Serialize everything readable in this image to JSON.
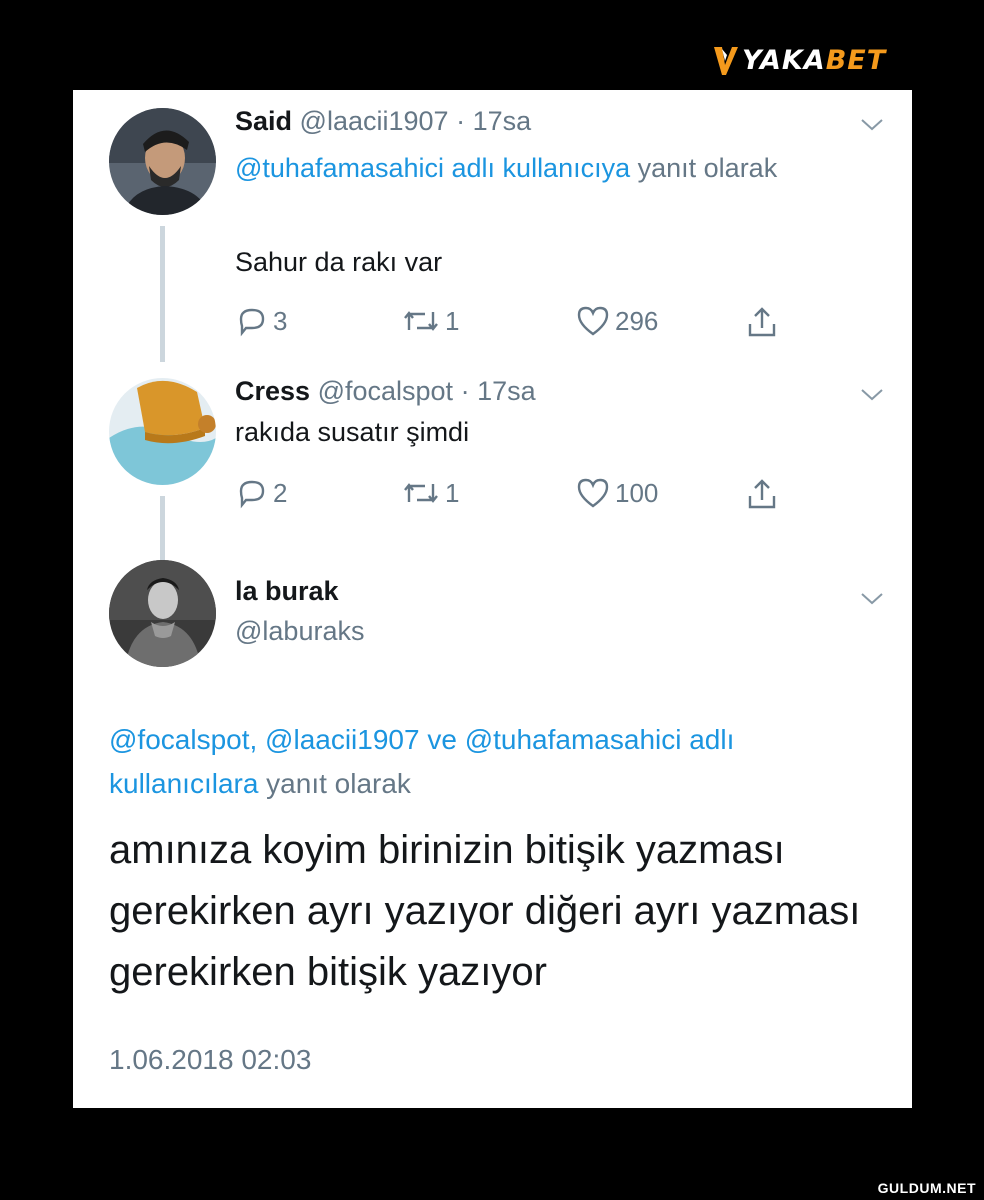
{
  "brand": {
    "logo_main": "YAKA",
    "logo_accent": "BET",
    "accent_color": "#f59a1c"
  },
  "watermark": "GULDUM.NET",
  "tweets": [
    {
      "name": "Said",
      "handle": "@laacii1907",
      "time": "· 17sa",
      "reply_link": "@tuhafamasahici adlı kullanıcıya",
      "reply_suffix": " yanıt olarak",
      "text": "Sahur da rakı var",
      "replies": "3",
      "retweets": "1",
      "likes": "296"
    },
    {
      "name": "Cress",
      "handle": "@focalspot",
      "time": "· 17sa",
      "text": "rakıda susatır şimdi",
      "replies": "2",
      "retweets": "1",
      "likes": "100"
    }
  ],
  "main": {
    "name": "la burak",
    "handle": "@laburaks",
    "reply_links": "@focalspot, @laacii1907 ve @tuhafamasahici adlı kullanıcılara",
    "reply_suffix": " yanıt olarak",
    "text": "amınıza koyim birinizin bitişik yazması gerekirken ayrı yazıyor diğeri ayrı yazması gerekirken bitişik yazıyor",
    "date": "1.06.2018 02:03"
  },
  "colors": {
    "link": "#1b95e0",
    "muted": "#657786",
    "text": "#14171a",
    "thread": "#ccd6dd"
  },
  "icons": [
    "reply-icon",
    "retweet-icon",
    "like-icon",
    "share-icon",
    "chevron-down-icon"
  ]
}
